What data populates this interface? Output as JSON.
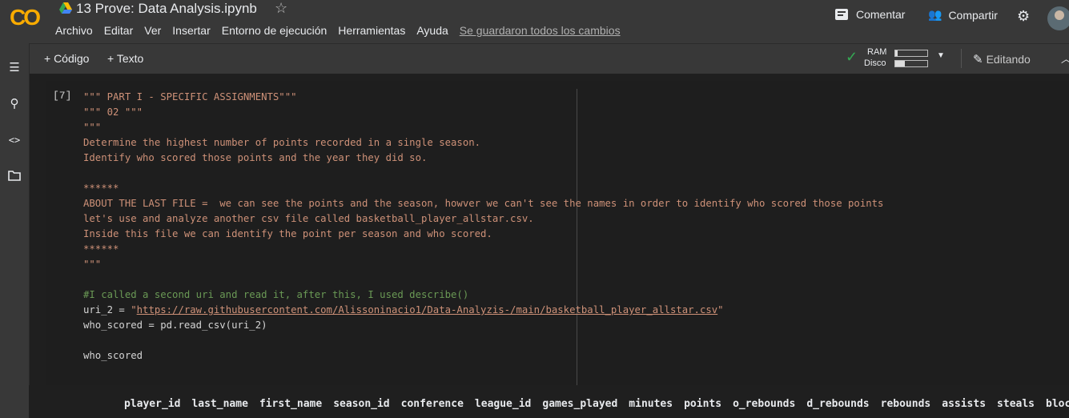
{
  "header": {
    "logo": "CO",
    "title": "13 Prove: Data Analysis.ipynb",
    "menu": [
      "Archivo",
      "Editar",
      "Ver",
      "Insertar",
      "Entorno de ejecución",
      "Herramientas",
      "Ayuda"
    ],
    "saved_status": "Se guardaron todos los cambios",
    "comment_label": "Comentar",
    "share_label": "Compartir"
  },
  "toolbar": {
    "code_label": "+ Código",
    "text_label": "+ Texto",
    "ram_label": "RAM",
    "disk_label": "Disco",
    "editing_label": "Editando"
  },
  "cell": {
    "execution_count": "[7]",
    "lines": [
      {
        "t": "str",
        "text": "\"\"\" PART I - SPECIFIC ASSIGNMENTS\"\"\""
      },
      {
        "t": "str",
        "text": "\"\"\" 02 \"\"\""
      },
      {
        "t": "str",
        "text": "\"\"\""
      },
      {
        "t": "str",
        "text": "Determine the highest number of points recorded in a single season."
      },
      {
        "t": "str",
        "text": "Identify who scored those points and the year they did so."
      },
      {
        "t": "str",
        "text": ""
      },
      {
        "t": "str",
        "text": "******"
      },
      {
        "t": "str",
        "text": "ABOUT THE LAST FILE =  we can see the points and the season, howver we can't see the names in order to identify who scored those points"
      },
      {
        "t": "str",
        "text": "let's use and analyze another csv file called basketball_player_allstar.csv."
      },
      {
        "t": "str",
        "text": "Inside this file we can identify the point per season and who scored."
      },
      {
        "t": "str",
        "text": "******"
      },
      {
        "t": "str",
        "text": "\"\"\""
      },
      {
        "t": "str",
        "text": ""
      },
      {
        "t": "cmt",
        "text": "#I called a second uri and read it, after this, I used describe()"
      },
      {
        "t": "uri",
        "prefix": "uri_2 = ",
        "quote": "\"",
        "url": "https://raw.githubusercontent.com/Alissoninacio1/Data-Analyzis-/main/basketball_player_allstar.csv"
      },
      {
        "t": "plain",
        "text": "who_scored = pd.read_csv(uri_2)"
      },
      {
        "t": "plain",
        "text": ""
      },
      {
        "t": "plain",
        "text": "who_scored"
      }
    ]
  },
  "output": {
    "columns": [
      "player_id",
      "last_name",
      "first_name",
      "season_id",
      "conference",
      "league_id",
      "games_played",
      "minutes",
      "points",
      "o_rebounds",
      "d_rebounds",
      "rebounds",
      "assists",
      "steals",
      "blocks"
    ]
  }
}
